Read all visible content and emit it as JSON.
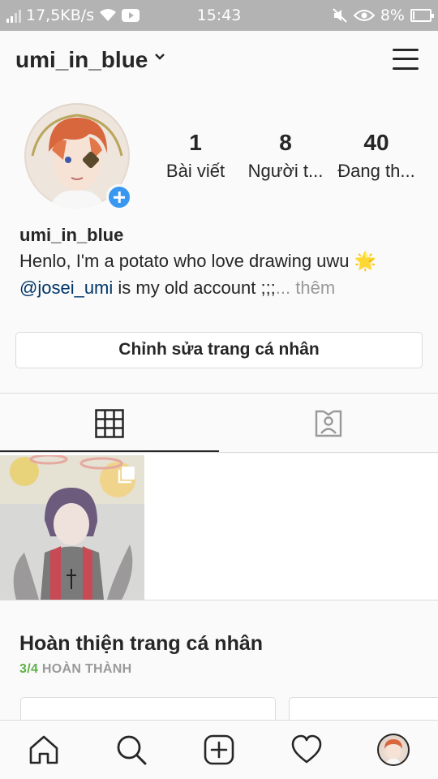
{
  "status_bar": {
    "network_speed": "17,5KB/s",
    "time": "15:43",
    "battery": "8%"
  },
  "header": {
    "username": "umi_in_blue"
  },
  "profile": {
    "stats": [
      {
        "value": "1",
        "label": "Bài viết"
      },
      {
        "value": "8",
        "label": "Người t..."
      },
      {
        "value": "40",
        "label": "Đang th..."
      }
    ],
    "name": "umi_in_blue",
    "bio_line1": "Henlo, I'm a potato who love drawing uwu 🌟",
    "bio_mention": "@josei_umi",
    "bio_line2_rest": " is my old account ;;;",
    "bio_more": "... thêm",
    "edit_button": "Chỉnh sửa trang cá nhân"
  },
  "complete_profile": {
    "title": "Hoàn thiện trang cá nhân",
    "progress": "3/4",
    "progress_label": "HOÀN THÀNH"
  },
  "colors": {
    "accent_blue": "#3897f0",
    "link": "#003569",
    "progress_green": "#5eb144",
    "text": "#262626",
    "muted": "#999999"
  },
  "icons": {
    "tabs": [
      "grid-icon",
      "tagged-icon"
    ],
    "bottom_nav": [
      "home-icon",
      "search-icon",
      "add-post-icon",
      "activity-heart-icon",
      "profile-avatar"
    ]
  }
}
